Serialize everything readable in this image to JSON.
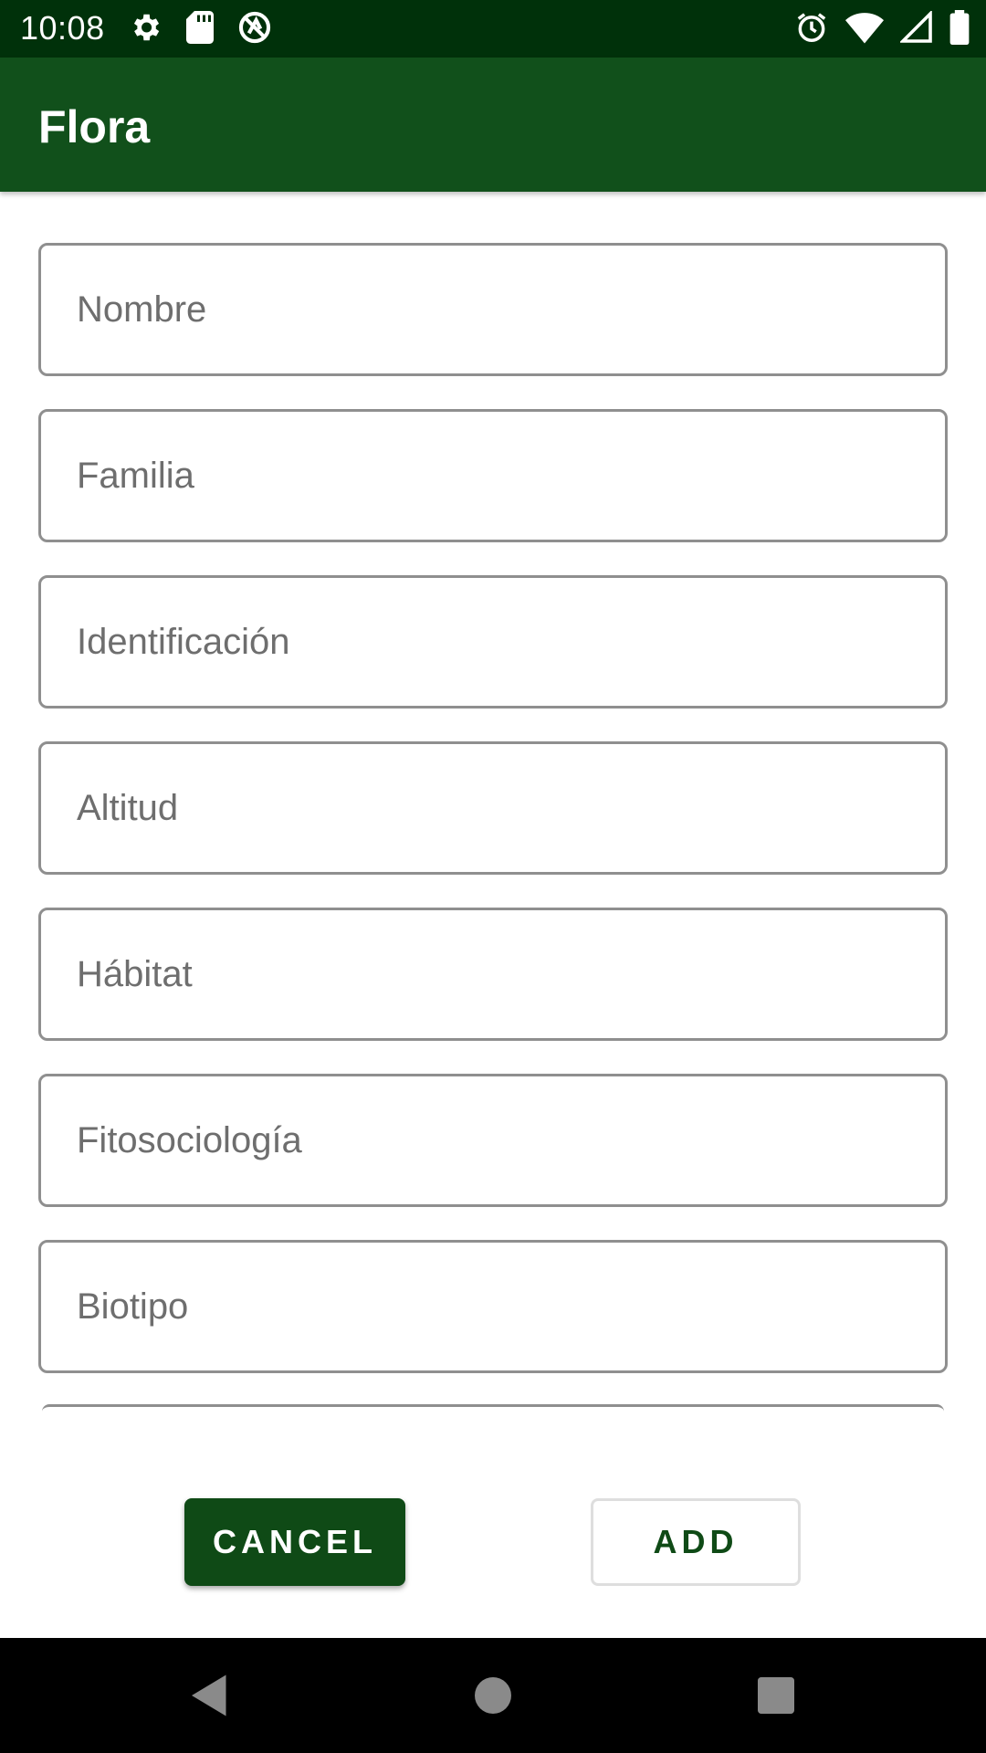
{
  "status_bar": {
    "time": "10:08",
    "left_icons": [
      "settings-icon",
      "sd-card-icon",
      "no-tracking-icon"
    ],
    "right_icons": [
      "alarm-icon",
      "wifi-icon",
      "signal-icon",
      "battery-icon"
    ]
  },
  "app_bar": {
    "title": "Flora",
    "color": "#11501b"
  },
  "form": {
    "fields": [
      {
        "name": "nombre",
        "placeholder": "Nombre",
        "value": ""
      },
      {
        "name": "familia",
        "placeholder": "Familia",
        "value": ""
      },
      {
        "name": "identificacion",
        "placeholder": "Identificación",
        "value": ""
      },
      {
        "name": "altitud",
        "placeholder": "Altitud",
        "value": ""
      },
      {
        "name": "habitat",
        "placeholder": "Hábitat",
        "value": ""
      },
      {
        "name": "fitosociologia",
        "placeholder": "Fitosociología",
        "value": ""
      },
      {
        "name": "biotipo",
        "placeholder": "Biotipo",
        "value": ""
      }
    ]
  },
  "actions": {
    "cancel_label": "CANCEL",
    "add_label": "ADD",
    "accent": "#0f4a16"
  },
  "nav_bar": {
    "buttons": [
      "back-icon",
      "home-icon",
      "recents-icon"
    ]
  }
}
